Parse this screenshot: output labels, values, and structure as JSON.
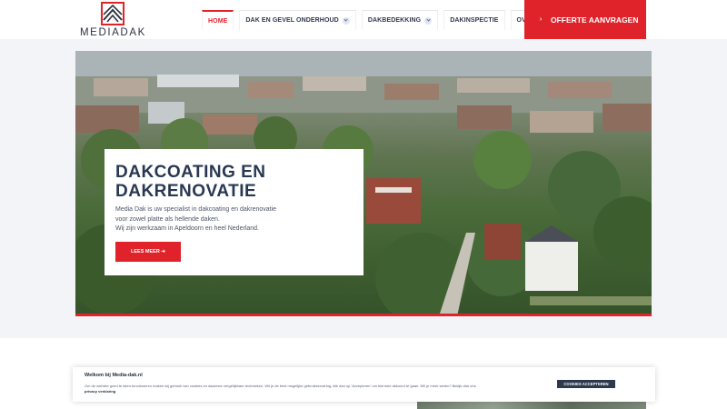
{
  "header": {
    "logo_text": "MEDIADAK",
    "nav": [
      {
        "label": "HOME",
        "active": true,
        "has_dropdown": false
      },
      {
        "label": "DAK EN GEVEL ONDERHOUD",
        "active": false,
        "has_dropdown": true
      },
      {
        "label": "DAKBEDEKKING",
        "active": false,
        "has_dropdown": true
      },
      {
        "label": "DAKINSPECTIE",
        "active": false,
        "has_dropdown": false
      },
      {
        "label": "OVER ONS",
        "active": false,
        "has_dropdown": true
      }
    ],
    "cta_label": "OFFERTE AANVRAGEN"
  },
  "hero": {
    "title_line1": "DAKCOATING EN",
    "title_line2": "DAKRENOVATIE",
    "desc_line1": "Media Dak is uw specialist in dakcoating en dakrenovatie",
    "desc_line2": "voor zowel platte als hellende daken.",
    "desc_line3": "Wij zijn werkzaam in Apeldoorn en heel Nederland.",
    "button_label": "LEES MEER ➔"
  },
  "cookie": {
    "title": "Welkom bij Media-dak.nl",
    "text": "Om de website goed te laten functioneren maken wij gebruik van cookies en daarmee vergelijkbare technieken. Wil je de best mogelijke gebruikservaring, klik dan op 'Accepteren' om hiermee akkoord te gaan. Wil je meer weten? Bekijk dan ons",
    "link": "privacy verklaring",
    "button_label": "COOKIES ACCEPTEREN"
  },
  "colors": {
    "accent": "#e0232b",
    "navy": "#283852"
  },
  "icons": {
    "logo": "roof-logo-icon",
    "cta": "chevron-right-icon",
    "dropdown": "chevron-down-icon"
  }
}
